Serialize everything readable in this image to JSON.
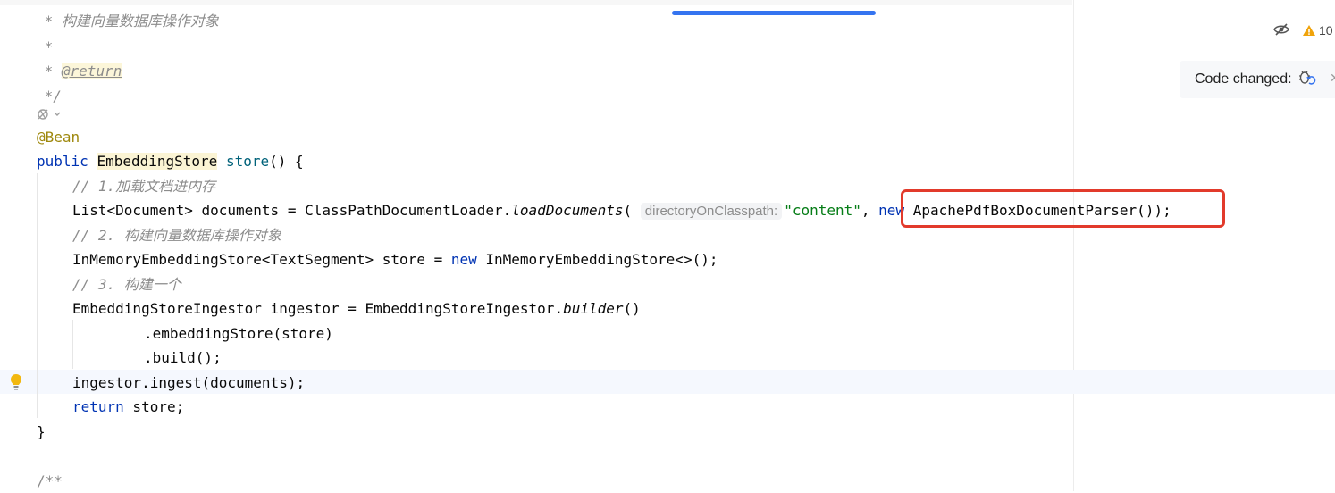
{
  "editor": {
    "lines": {
      "doc_comment_title": " * 构建向量数据库操作对象",
      "doc_star": " *",
      "doc_star_prefix": " * ",
      "doc_return_tag": "@return",
      "doc_end": " */",
      "annotation": "@Bean",
      "method_kw": "public ",
      "method_return_type": "EmbeddingStore",
      "method_space": " ",
      "method_name": "store",
      "method_tail": "() {",
      "comment_1": "// 1.加载文档进内存",
      "load_prefix": "List<Document> documents = ClassPathDocumentLoader.",
      "load_method": "loadDocuments",
      "load_paren": "(",
      "param_hint": "directoryOnClasspath:",
      "load_string": "\"content\"",
      "load_comma": ", ",
      "load_new_kw": "new",
      "load_parser": " ApachePdfBoxDocumentParser());",
      "comment_2": "// 2. 构建向量数据库操作对象",
      "store_prefix": "InMemoryEmbeddingStore<TextSegment> store = ",
      "store_new_kw": "new",
      "store_suffix": " InMemoryEmbeddingStore<>();",
      "comment_3": "// 3. 构建一个",
      "ingestor_prefix": "EmbeddingStoreIngestor ingestor = EmbeddingStoreIngestor.",
      "ingestor_builder": "builder",
      "ingestor_suffix": "()",
      "chain_store": ".embeddingStore(store)",
      "chain_build": ".build();",
      "ingest_call": "ingestor.ingest(documents);",
      "return_kw": "return",
      "return_rest": " store;",
      "close_brace": "}",
      "next_doc_start": "/**"
    }
  },
  "toolbar": {
    "warning_count": "10"
  },
  "notification": {
    "code_changed_label": "Code changed:"
  },
  "colors": {
    "keyword": "#0033b3",
    "comment": "#8c8c8c",
    "string": "#067d17",
    "annotation": "#9e880d",
    "method_declaration": "#00627a",
    "highlight_box": "#e23a2b",
    "scroll_indicator": "#3574f0"
  }
}
